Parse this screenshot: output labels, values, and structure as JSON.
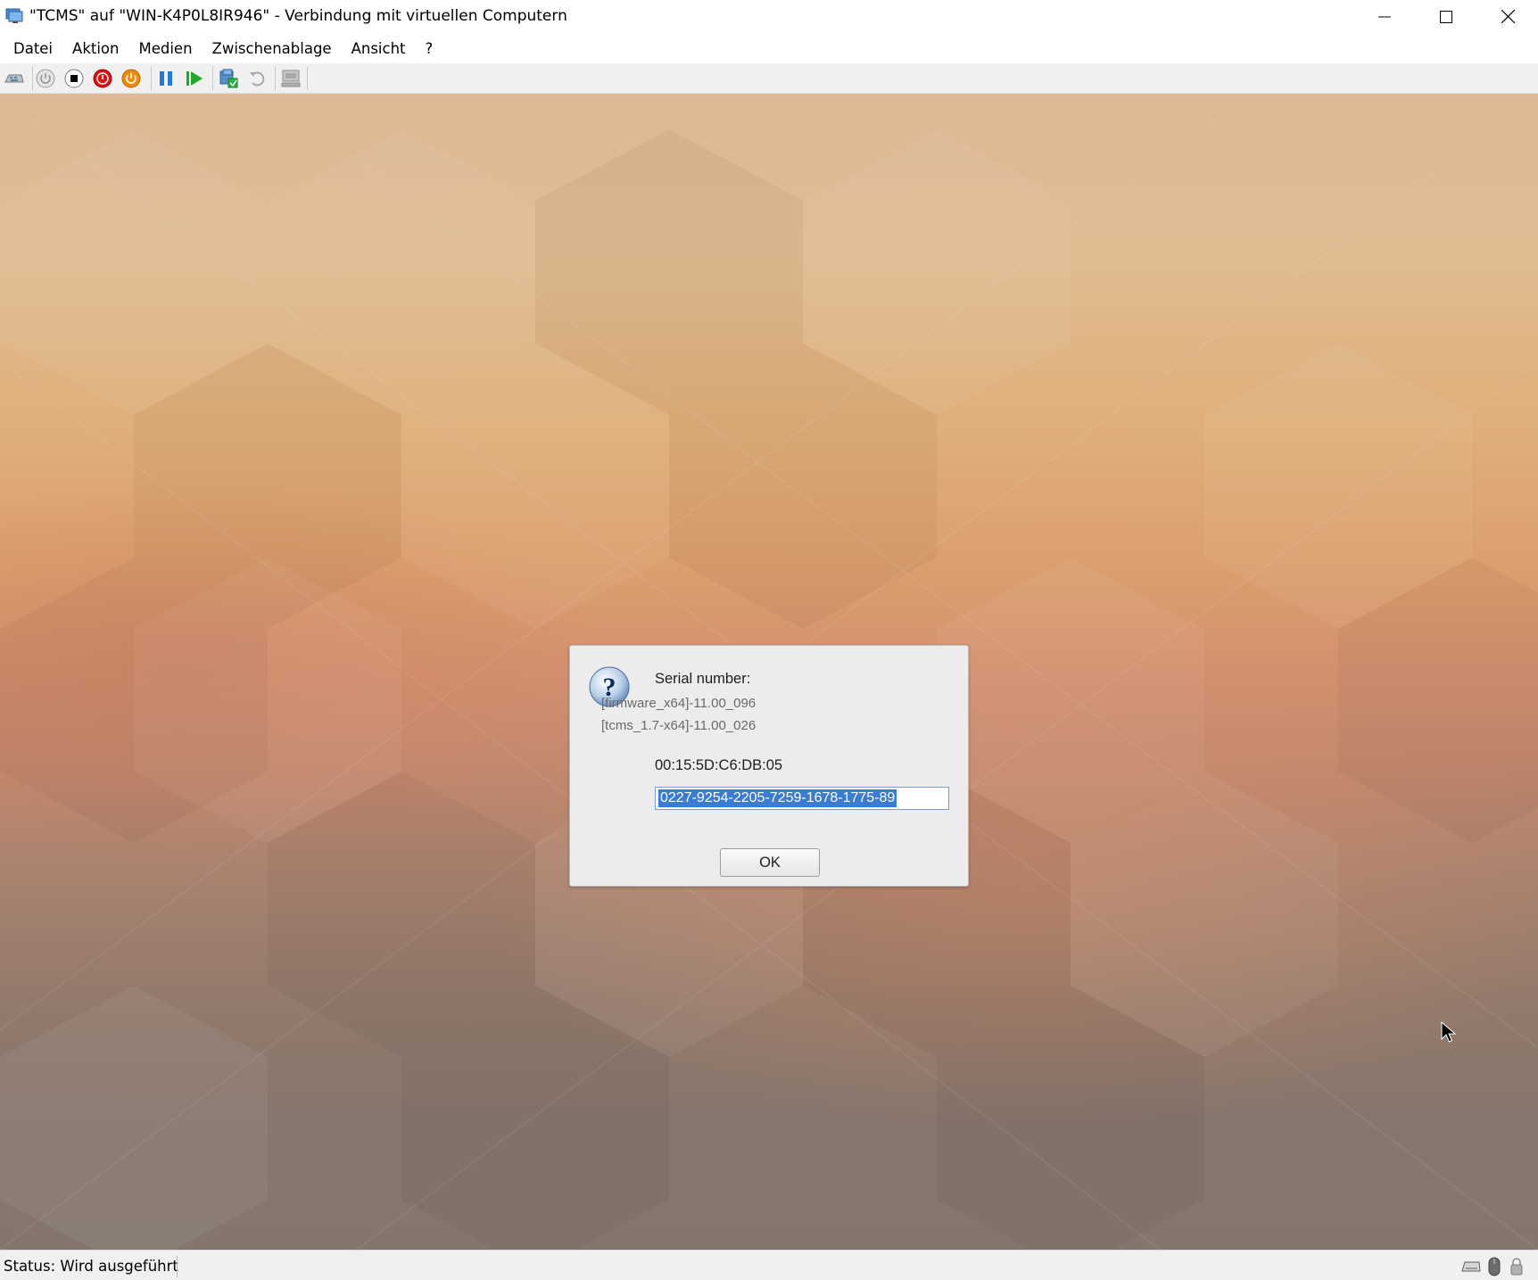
{
  "window": {
    "title": "\"TCMS\" auf \"WIN-K4P0L8IR946\" - Verbindung mit virtuellen Computern",
    "controls": [
      "minimize-icon",
      "maximize-icon",
      "close-icon"
    ]
  },
  "menu": {
    "items": [
      {
        "label": "Datei"
      },
      {
        "label": "Aktion"
      },
      {
        "label": "Medien"
      },
      {
        "label": "Zwischenablage"
      },
      {
        "label": "Ansicht"
      },
      {
        "label": "?"
      }
    ]
  },
  "toolbar": {
    "buttons": [
      "ctrl-alt-del-icon",
      "start-icon",
      "turn-off-icon",
      "shutdown-icon",
      "save-state-icon",
      "pause-icon",
      "resume-icon",
      "checkpoint-icon",
      "revert-icon",
      "enhanced-session-icon"
    ],
    "colors": {
      "shutdown_red": "#e01010",
      "save_orange": "#f08a00",
      "pause_blue": "#1f7ad8",
      "resume_green": "#1fa82e"
    }
  },
  "dialog": {
    "title": "Serial number:",
    "line1": "[firmware_x64]-11.00_096",
    "line2": "[tcms_1.7-x64]-11.00_026",
    "mac": "00:15:5D:C6:DB:05",
    "serial_value": "0227-9254-2205-7259-1678-1775-89",
    "ok_label": "OK",
    "icon": "question-icon"
  },
  "statusbar": {
    "status": "Status: Wird ausgeführt",
    "icons": [
      "keyboard-icon",
      "mouse-icon",
      "lock-icon"
    ]
  }
}
